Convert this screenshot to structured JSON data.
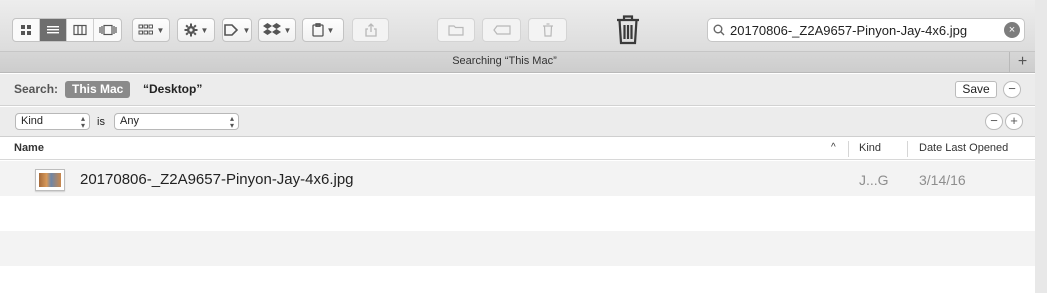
{
  "toolbar": {
    "view_buttons": [
      "icon-view",
      "list-view",
      "column-view",
      "cover-flow-view"
    ],
    "active_view": "list-view",
    "arrange_icon": "arrange-grid-icon",
    "action_icon": "gear-icon",
    "tag_icon": "tag-icon",
    "dropbox_icon": "dropbox-icon",
    "delete_icon": "trash-icon"
  },
  "search": {
    "value": "20170806-_Z2A9657-Pinyon-Jay-4x6.jpg",
    "clear_symbol": "×"
  },
  "tabbar": {
    "title": "Searching “This Mac”",
    "add_symbol": "+"
  },
  "scope": {
    "label": "Search:",
    "active": "This Mac",
    "other": "“Desktop”",
    "save_label": "Save",
    "minus": "−"
  },
  "criteria": {
    "attribute": "Kind",
    "operator": "is",
    "value": "Any",
    "minus": "−",
    "plus": "+"
  },
  "columns": {
    "name": "Name",
    "sort_indicator": "^",
    "kind": "Kind",
    "date": "Date Last Opened"
  },
  "files": [
    {
      "name": "20170806-_Z2A9657-Pinyon-Jay-4x6.jpg",
      "kind": "J...G",
      "date": "3/14/16"
    }
  ],
  "colors": {
    "accent_active": "#6e6e6e",
    "scope_active_bg": "#8a8a8a",
    "muted_text": "#8e8e8e"
  }
}
